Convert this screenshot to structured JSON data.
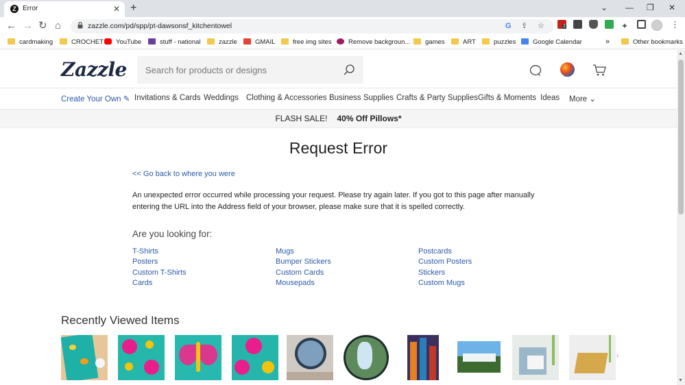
{
  "browser": {
    "tab_title": "Error",
    "tab_favicon_letter": "Z",
    "url": "zazzle.com/pd/spp/pt-dawsonsf_kitchentowel",
    "bookmarks": [
      {
        "label": "cardmaking",
        "icon": "folder-icon"
      },
      {
        "label": "CROCHET",
        "icon": "folder-icon"
      },
      {
        "label": "YouTube",
        "icon": "youtube-icon"
      },
      {
        "label": "stuff - national",
        "icon": "s-icon"
      },
      {
        "label": "zazzle",
        "icon": "folder-icon"
      },
      {
        "label": "GMAIL",
        "icon": "gmail-icon"
      },
      {
        "label": "free img sites",
        "icon": "folder-icon"
      },
      {
        "label": "Remove backgroun...",
        "icon": "remove-bg-icon"
      },
      {
        "label": "games",
        "icon": "folder-icon"
      },
      {
        "label": "ART",
        "icon": "folder-icon"
      },
      {
        "label": "puzzles",
        "icon": "folder-icon"
      },
      {
        "label": "Google Calendar",
        "icon": "calendar-icon"
      }
    ],
    "bookmarks_overflow": "»",
    "other_bookmarks": "Other bookmarks",
    "extension_badge": "2"
  },
  "site": {
    "logo": "Zazzle",
    "search_placeholder": "Search for products or designs",
    "nav": [
      "Create Your Own ✎",
      "Invitations & Cards",
      "Weddings",
      "Clothing & Accessories",
      "Business Supplies",
      "Crafts & Party Supplies",
      "Gifts & Moments",
      "Ideas",
      "More ⌄"
    ],
    "promo_text": "FLASH SALE!",
    "promo_bold": "40% Off Pillows*"
  },
  "error": {
    "title": "Request Error",
    "back_link": "<< Go back to where you were",
    "message": "An unexpected error occurred while processing your request. Please try again later. If you got to this page after manually entering the URL into the Address field of your browser, please make sure that it is spelled correctly.",
    "looking_for": "Are you looking for:",
    "suggestions": [
      [
        "T-Shirts",
        "Posters",
        "Custom T-Shirts",
        "Cards"
      ],
      [
        "Mugs",
        "Bumper Stickers",
        "Custom Cards",
        "Mousepads"
      ],
      [
        "Postcards",
        "Custom Posters",
        "Stickers",
        "Custom Mugs"
      ]
    ]
  },
  "recent": {
    "title": "Recently Viewed Items",
    "items": [
      "kitchen-towel-thumbnail",
      "pink-floral-pattern-thumbnail",
      "butterfly-pattern-thumbnail",
      "floral-pattern-thumbnail",
      "clock-thumbnail",
      "waterfall-clock-thumbnail",
      "city-poster-thumbnail",
      "waterfall-photo-thumbnail",
      "card-mockup-thumbnail",
      "greeting-card-thumbnail"
    ]
  },
  "colors": {
    "link": "#2a5aa8",
    "logo": "#1d2a44",
    "promo_bg": "#f5f5f5"
  }
}
